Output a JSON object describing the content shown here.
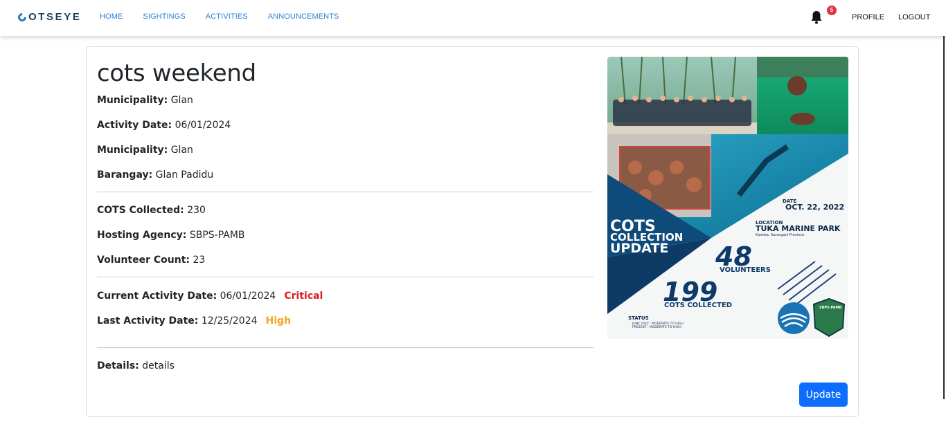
{
  "nav": {
    "brand": "COTSEYE",
    "brand_rest": "OTSEYE",
    "links": [
      "HOME",
      "SIGHTINGS",
      "ACTIVITIES",
      "ANNOUNCEMENTS"
    ],
    "notification_count": "5",
    "profile": "PROFILE",
    "logout": "LOGOUT"
  },
  "activity": {
    "title": "cots weekend",
    "municipality_label": "Municipality:",
    "municipality": "Glan",
    "activity_date_label": "Activity Date:",
    "activity_date": "06/01/2024",
    "municipality2_label": "Municipality:",
    "municipality2": "Glan",
    "barangay_label": "Barangay:",
    "barangay": "Glan Padidu",
    "cots_collected_label": "COTS Collected:",
    "cots_collected": "230",
    "hosting_agency_label": "Hosting Agency:",
    "hosting_agency": "SBPS-PAMB",
    "volunteer_count_label": "Volunteer Count:",
    "volunteer_count": "23",
    "current_activity_label": "Current Activity Date:",
    "current_activity_date": "06/01/2024",
    "current_status": "Critical",
    "last_activity_label": "Last Activity Date:",
    "last_activity_date": "12/25/2024",
    "last_status": "High",
    "details_label": "Details:",
    "details": "details",
    "update_button": "Update"
  },
  "poster": {
    "date_label": "DATE",
    "date": "OCT. 22, 2022",
    "location_label": "LOCATION",
    "location": "TUKA MARINE PARK",
    "location_sub": "Kiamba, Sarangani Province",
    "headline_1": "COTS",
    "headline_2": "COLLECTION",
    "headline_3": "UPDATE",
    "volunteers_number": "48",
    "volunteers_label": "VOLUNTEERS",
    "collected_number": "199",
    "collected_label": "COTS COLLECTED",
    "status_label": "STATUS",
    "status_line_1": "JUNE 2022 : MODERATE TO HIGH",
    "status_line_2": "PRESENT : MODERATE TO HIGH",
    "logo_text": "SBPS PAMB"
  },
  "colors": {
    "nav_link": "#2a7fd4",
    "critical": "#dc1f1f",
    "high": "#f5a31a",
    "button": "#0d6efd",
    "poster_navy": "#0e3a66"
  }
}
